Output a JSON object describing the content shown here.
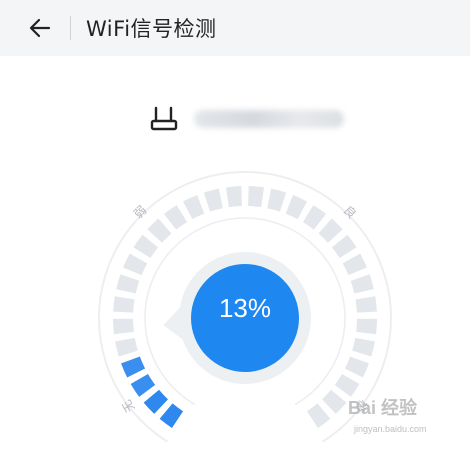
{
  "header": {
    "title": "WiFi信号检测",
    "back_icon": "arrow-left-icon"
  },
  "network": {
    "router_icon": "router-icon",
    "ssid": ""
  },
  "gauge": {
    "percent_label": "13%",
    "level_fraction": 0.13,
    "segment_count": 30,
    "labels": {
      "weak": "弱",
      "good": "良",
      "none": "无",
      "excellent": "极"
    },
    "colors": {
      "active": "#3a8ef0",
      "active_strong": "#2f88ee",
      "inactive": "#e3e6ea",
      "ring": "#eceef1",
      "center": "#1e88f0",
      "center_halo": "#edf0f3"
    }
  },
  "watermark": {
    "main": "Bai 经验",
    "sub": "jingyan.baidu.com"
  }
}
